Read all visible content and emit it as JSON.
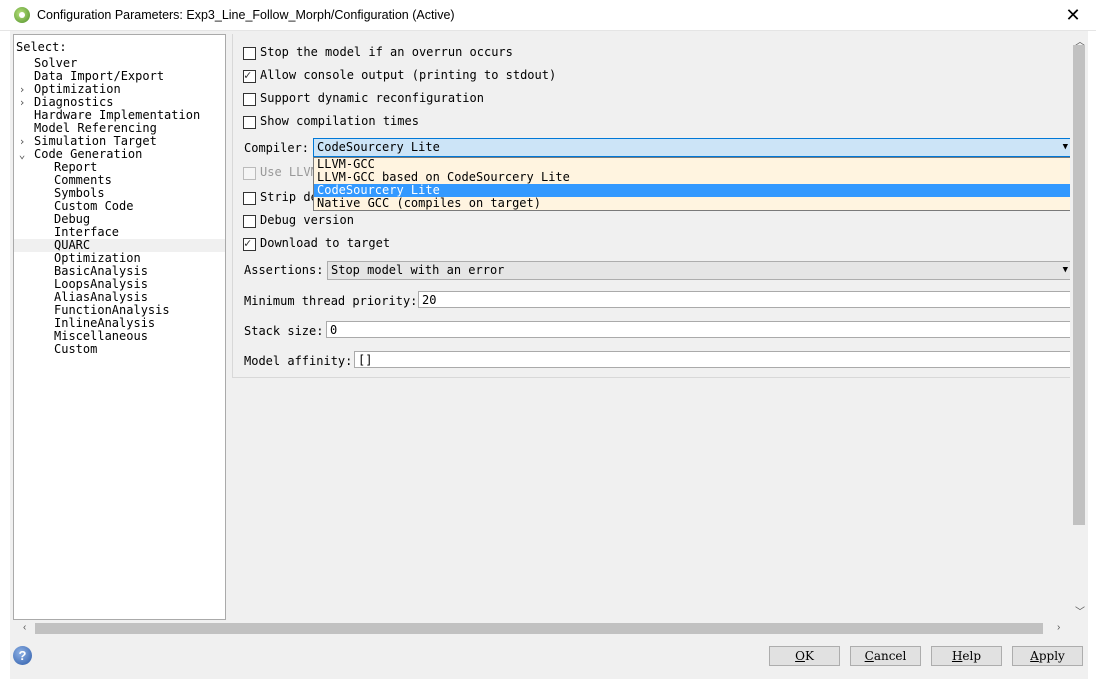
{
  "window": {
    "title": "Configuration Parameters: Exp3_Line_Follow_Morph/Configuration (Active)",
    "close_glyph": "✕",
    "app_icon": "simulink-icon"
  },
  "tree": {
    "header": "Select:",
    "items": [
      {
        "label": "Solver",
        "level": 0,
        "expander": ""
      },
      {
        "label": "Data Import/Export",
        "level": 0,
        "expander": ""
      },
      {
        "label": "Optimization",
        "level": 0,
        "expander": "›"
      },
      {
        "label": "Diagnostics",
        "level": 0,
        "expander": "›"
      },
      {
        "label": "Hardware Implementation",
        "level": 0,
        "expander": ""
      },
      {
        "label": "Model Referencing",
        "level": 0,
        "expander": ""
      },
      {
        "label": "Simulation Target",
        "level": 0,
        "expander": "›"
      },
      {
        "label": "Code Generation",
        "level": 0,
        "expander": "⌄"
      },
      {
        "label": "Report",
        "level": 1,
        "expander": ""
      },
      {
        "label": "Comments",
        "level": 1,
        "expander": ""
      },
      {
        "label": "Symbols",
        "level": 1,
        "expander": ""
      },
      {
        "label": "Custom Code",
        "level": 1,
        "expander": ""
      },
      {
        "label": "Debug",
        "level": 1,
        "expander": ""
      },
      {
        "label": "Interface",
        "level": 1,
        "expander": ""
      },
      {
        "label": "QUARC",
        "level": 1,
        "expander": "",
        "selected": true
      },
      {
        "label": "Optimization",
        "level": 1,
        "expander": ""
      },
      {
        "label": "BasicAnalysis",
        "level": 1,
        "expander": ""
      },
      {
        "label": "LoopsAnalysis",
        "level": 1,
        "expander": ""
      },
      {
        "label": "AliasAnalysis",
        "level": 1,
        "expander": ""
      },
      {
        "label": "FunctionAnalysis",
        "level": 1,
        "expander": ""
      },
      {
        "label": "InlineAnalysis",
        "level": 1,
        "expander": ""
      },
      {
        "label": "Miscellaneous",
        "level": 1,
        "expander": ""
      },
      {
        "label": "Custom",
        "level": 1,
        "expander": ""
      }
    ]
  },
  "options": {
    "stop_overrun": {
      "label": "Stop the model if an overrun occurs",
      "checked": false
    },
    "allow_console": {
      "label": "Allow console output (printing to stdout)",
      "checked": true
    },
    "support_dynamic": {
      "label": "Support dynamic reconfiguration",
      "checked": false
    },
    "show_compilation": {
      "label": "Show compilation times",
      "checked": false
    },
    "use_llvm": {
      "label": "Use LLVM",
      "checked": false,
      "enabled": false
    },
    "strip": {
      "label": "Strip de",
      "checked": false
    },
    "debug_version": {
      "label": "Debug version",
      "checked": false
    },
    "download_target": {
      "label": "Download to target",
      "checked": true
    }
  },
  "compiler": {
    "label": "Compiler:",
    "value": "CodeSourcery Lite",
    "options": [
      "LLVM-GCC",
      "LLVM-GCC based on CodeSourcery Lite",
      "CodeSourcery Lite",
      "Native GCC (compiles on target)"
    ],
    "selected_index": 2
  },
  "assertions": {
    "label": "Assertions:",
    "value": "Stop model with an error"
  },
  "min_thread_priority": {
    "label": "Minimum thread priority:",
    "value": "20"
  },
  "stack_size": {
    "label": "Stack size:",
    "value": "0"
  },
  "model_affinity": {
    "label": "Model affinity:",
    "value": "[]"
  },
  "buttons": {
    "ok": {
      "accel": "O",
      "rest": "K"
    },
    "cancel": {
      "accel": "C",
      "rest": "ancel"
    },
    "help": {
      "accel": "H",
      "rest": "elp"
    },
    "apply": {
      "accel": "A",
      "rest": "pply"
    }
  },
  "icons": {
    "help": "help-icon",
    "dropdown_arrow": "▼"
  }
}
